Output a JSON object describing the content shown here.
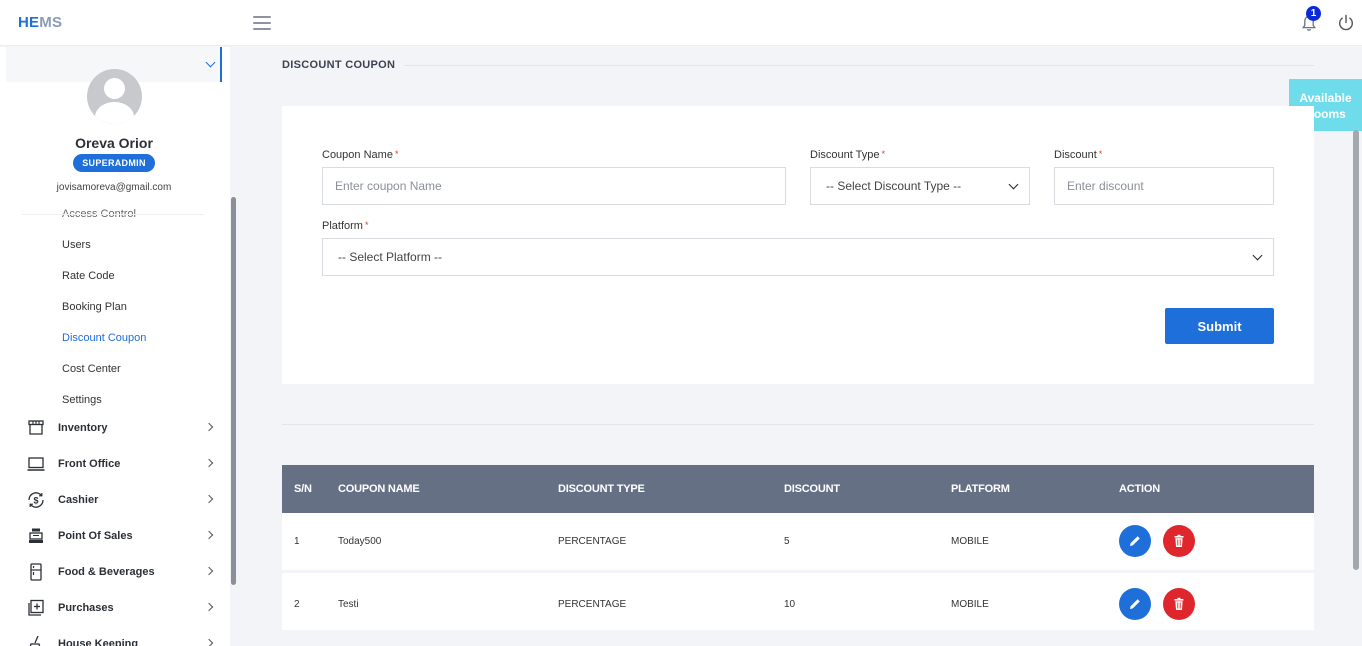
{
  "app": {
    "logo_part1": "HE",
    "logo_part2": "MS",
    "notification_count": "1"
  },
  "user": {
    "name": "Oreva Orior",
    "role": "SUPERADMIN",
    "email": "jovisamoreva@gmail.com"
  },
  "sidebar": {
    "cut_item": "Access Control",
    "sub_items": [
      "Users",
      "Rate Code",
      "Booking Plan",
      "Discount Coupon",
      "Cost Center",
      "Settings"
    ],
    "menu_items": [
      "Inventory",
      "Front Office",
      "Cashier",
      "Point Of Sales",
      "Food & Beverages",
      "Purchases",
      "House Keeping"
    ]
  },
  "page": {
    "title": "DISCOUNT COUPON",
    "available_rooms": "Available Rooms"
  },
  "form": {
    "coupon_name_label": "Coupon Name",
    "coupon_name_placeholder": "Enter coupon Name",
    "discount_type_label": "Discount Type",
    "discount_type_selected": "-- Select Discount Type --",
    "discount_label": "Discount",
    "discount_placeholder": "Enter discount",
    "platform_label": "Platform",
    "platform_selected": "-- Select Platform --",
    "required_mark": "*",
    "submit_label": "Submit"
  },
  "table": {
    "headers": [
      "S/N",
      "COUPON NAME",
      "DISCOUNT TYPE",
      "DISCOUNT",
      "PLATFORM",
      "ACTION"
    ],
    "rows": [
      [
        "1",
        "Today500",
        "PERCENTAGE",
        "5",
        "MOBILE"
      ],
      [
        "2",
        "Testi",
        "PERCENTAGE",
        "10",
        "MOBILE"
      ]
    ]
  },
  "colors": {
    "accent": "#1e6fd9",
    "table_header": "#667085",
    "delete": "#e0262d",
    "available_rooms": "#6fdcec"
  }
}
